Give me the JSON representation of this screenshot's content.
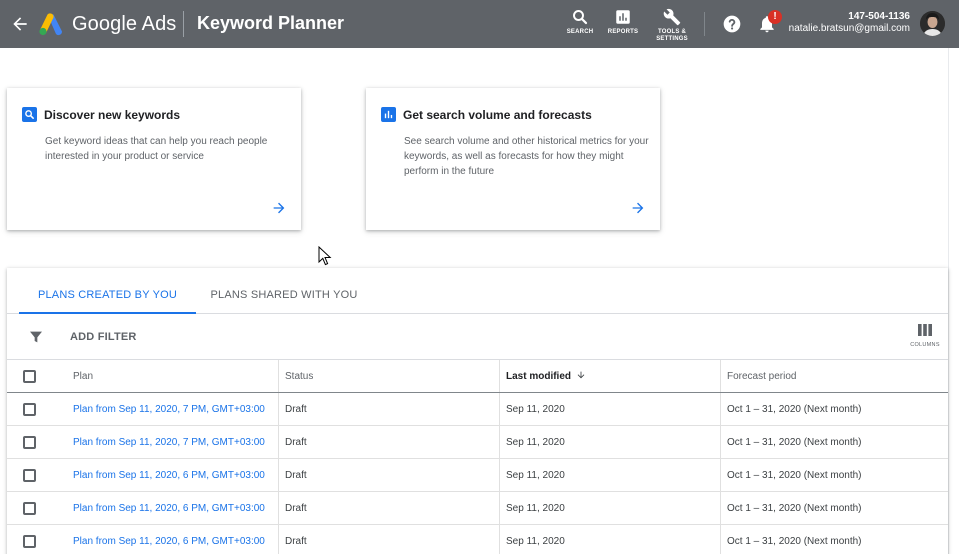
{
  "header": {
    "brand": "Google Ads",
    "title": "Keyword Planner",
    "tools": [
      {
        "label": "SEARCH",
        "icon": "search-icon"
      },
      {
        "label": "REPORTS",
        "icon": "reports-icon"
      },
      {
        "label_line1": "TOOLS &",
        "label_line2": "SETTINGS",
        "icon": "wrench-icon"
      }
    ],
    "notification_badge": "!",
    "account_id": "147-504-1136",
    "account_email": "natalie.bratsun@gmail.com"
  },
  "cards": [
    {
      "title": "Discover new keywords",
      "icon": "search-icon",
      "description": "Get keyword ideas that can help you reach people interested in your product or service"
    },
    {
      "title": "Get search volume and forecasts",
      "icon": "bar-chart-icon",
      "description": "See search volume and other historical metrics for your keywords, as well as forecasts for how they might perform in the future"
    }
  ],
  "tabs": [
    {
      "label": "PLANS CREATED BY YOU",
      "active": true
    },
    {
      "label": "PLANS SHARED WITH YOU",
      "active": false
    }
  ],
  "filter": {
    "add_filter_label": "ADD FILTER",
    "columns_label": "COLUMNS"
  },
  "table": {
    "columns": [
      "Plan",
      "Status",
      "Last modified",
      "Forecast period"
    ],
    "sort_column": "Last modified",
    "rows": [
      {
        "plan": "Plan from Sep 11, 2020, 7 PM, GMT+03:00",
        "status": "Draft",
        "modified": "Sep 11, 2020",
        "period": "Oct 1 – 31, 2020 (Next month)"
      },
      {
        "plan": "Plan from Sep 11, 2020, 7 PM, GMT+03:00",
        "status": "Draft",
        "modified": "Sep 11, 2020",
        "period": "Oct 1 – 31, 2020 (Next month)"
      },
      {
        "plan": "Plan from Sep 11, 2020, 6 PM, GMT+03:00",
        "status": "Draft",
        "modified": "Sep 11, 2020",
        "period": "Oct 1 – 31, 2020 (Next month)"
      },
      {
        "plan": "Plan from Sep 11, 2020, 6 PM, GMT+03:00",
        "status": "Draft",
        "modified": "Sep 11, 2020",
        "period": "Oct 1 – 31, 2020 (Next month)"
      },
      {
        "plan": "Plan from Sep 11, 2020, 6 PM, GMT+03:00",
        "status": "Draft",
        "modified": "Sep 11, 2020",
        "period": "Oct 1 – 31, 2020 (Next month)"
      }
    ]
  },
  "colors": {
    "header_bg": "#5f6368",
    "accent": "#1a73e8",
    "badge": "#d93025"
  }
}
